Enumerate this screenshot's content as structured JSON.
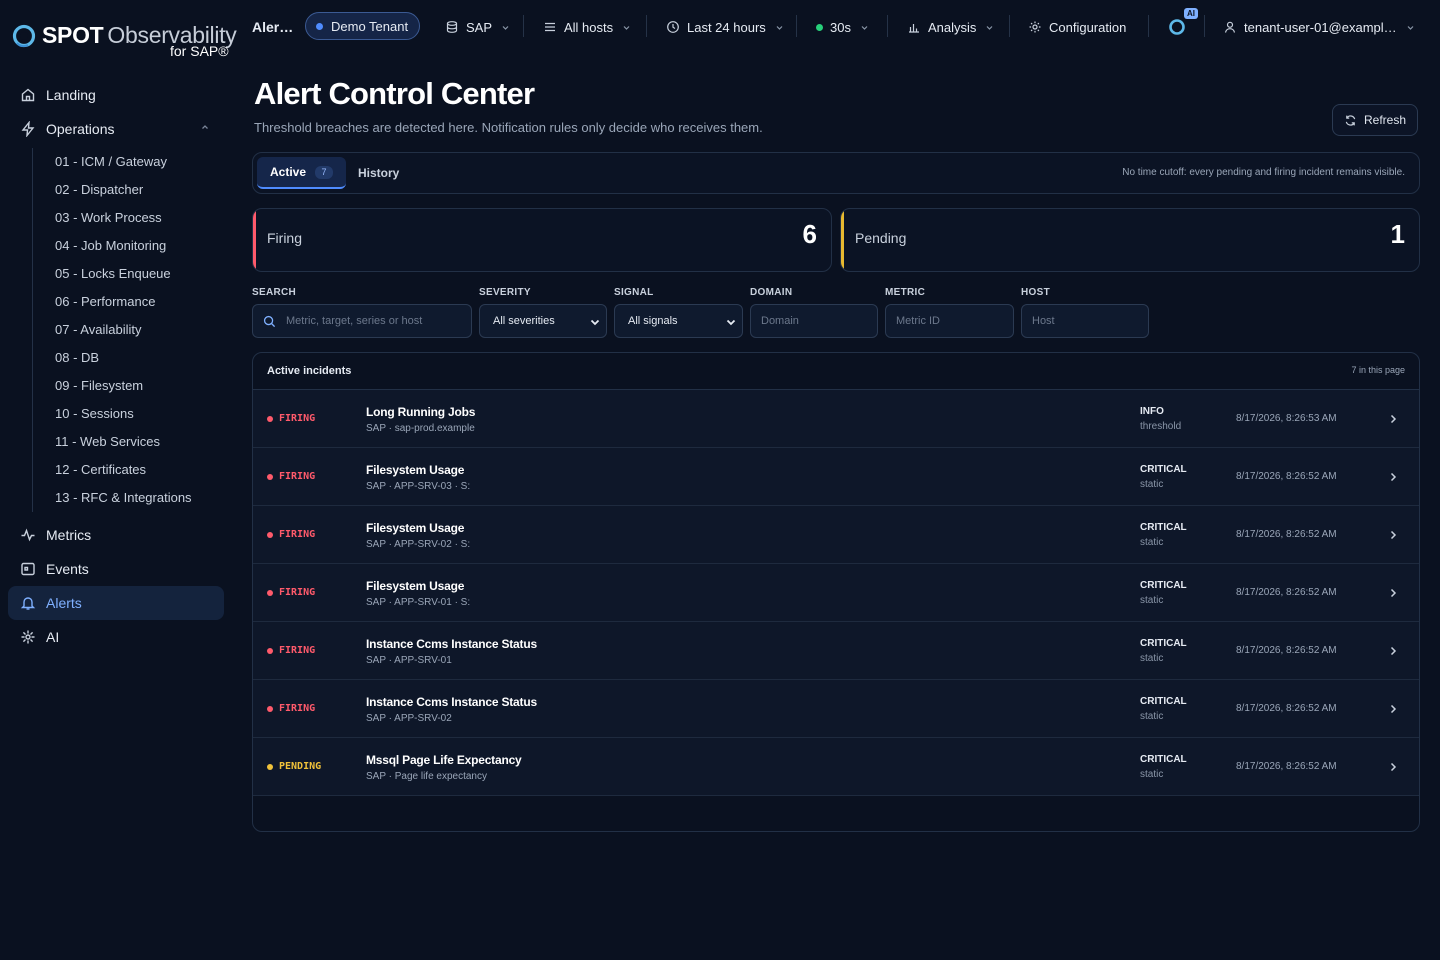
{
  "brand": {
    "name_bold": "SPOT",
    "name_light": "Observability",
    "suffix": "for SAP®"
  },
  "sidebar": {
    "items": [
      {
        "label": "Landing",
        "icon": "home-icon"
      },
      {
        "label": "Operations",
        "icon": "bolt-icon",
        "expanded": true
      },
      {
        "label": "Metrics",
        "icon": "activity-icon"
      },
      {
        "label": "Events",
        "icon": "calendar-icon"
      },
      {
        "label": "Alerts",
        "icon": "bell-icon",
        "active": true
      },
      {
        "label": "AI",
        "icon": "sparkle-icon"
      }
    ],
    "operations_sub": [
      "01 - ICM / Gateway",
      "02 - Dispatcher",
      "03 - Work Process",
      "04 - Job Monitoring",
      "05 - Locks Enqueue",
      "06 - Performance",
      "07 - Availability",
      "08 - DB",
      "09 - Filesystem",
      "10 - Sessions",
      "11 - Web Services",
      "12 - Certificates",
      "13 - RFC & Integrations"
    ]
  },
  "topbar": {
    "page_short": "Aler…",
    "tenant": "Demo Tenant",
    "system": "SAP",
    "hosts": "All hosts",
    "time_range": "Last 24 hours",
    "refresh_interval": "30s",
    "analysis": "Analysis",
    "configuration": "Configuration",
    "ai_badge": "AI",
    "user": "tenant-user-01@exampl…"
  },
  "header": {
    "title": "Alert Control Center",
    "subtitle": "Threshold breaches are detected here. Notification rules only decide who receives them.",
    "refresh_label": "Refresh"
  },
  "tabs": {
    "active_label": "Active",
    "active_count": "7",
    "history_label": "History",
    "note": "No time cutoff: every pending and firing incident remains visible."
  },
  "stats": {
    "firing_label": "Firing",
    "firing_value": "6",
    "pending_label": "Pending",
    "pending_value": "1"
  },
  "filters": {
    "search_label": "SEARCH",
    "search_placeholder": "Metric, target, series or host",
    "severity_label": "SEVERITY",
    "severity_value": "All severities",
    "signal_label": "SIGNAL",
    "signal_value": "All signals",
    "domain_label": "DOMAIN",
    "domain_placeholder": "Domain",
    "metric_label": "METRIC",
    "metric_placeholder": "Metric ID",
    "host_label": "HOST",
    "host_placeholder": "Host"
  },
  "incidents": {
    "title": "Active incidents",
    "count_note": "7 in this page",
    "rows": [
      {
        "state": "FIRING",
        "title": "Long Running Jobs",
        "meta": "SAP · sap-prod.example",
        "severity": "INFO",
        "kind": "threshold",
        "time": "8/17/2026, 8:26:53 AM"
      },
      {
        "state": "FIRING",
        "title": "Filesystem Usage",
        "meta": "SAP · APP-SRV-03 · S:",
        "severity": "CRITICAL",
        "kind": "static",
        "time": "8/17/2026, 8:26:52 AM"
      },
      {
        "state": "FIRING",
        "title": "Filesystem Usage",
        "meta": "SAP · APP-SRV-02 · S:",
        "severity": "CRITICAL",
        "kind": "static",
        "time": "8/17/2026, 8:26:52 AM"
      },
      {
        "state": "FIRING",
        "title": "Filesystem Usage",
        "meta": "SAP · APP-SRV-01 · S:",
        "severity": "CRITICAL",
        "kind": "static",
        "time": "8/17/2026, 8:26:52 AM"
      },
      {
        "state": "FIRING",
        "title": "Instance Ccms Instance Status",
        "meta": "SAP · APP-SRV-01",
        "severity": "CRITICAL",
        "kind": "static",
        "time": "8/17/2026, 8:26:52 AM"
      },
      {
        "state": "FIRING",
        "title": "Instance Ccms Instance Status",
        "meta": "SAP · APP-SRV-02",
        "severity": "CRITICAL",
        "kind": "static",
        "time": "8/17/2026, 8:26:52 AM"
      },
      {
        "state": "PENDING",
        "title": "Mssql Page Life Expectancy",
        "meta": "SAP · Page life expectancy",
        "severity": "CRITICAL",
        "kind": "static",
        "time": "8/17/2026, 8:26:52 AM"
      }
    ]
  },
  "colors": {
    "background": "#0a1120",
    "accent": "#4f8cff",
    "firing": "#ff5a6b",
    "pending": "#f0c23a",
    "live": "#27d07a"
  }
}
